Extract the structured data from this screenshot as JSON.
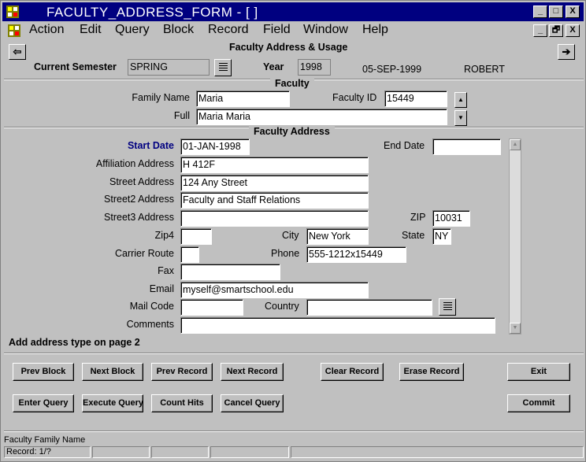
{
  "window": {
    "title": "FACULTY_ADDRESS_FORM - [ ]",
    "controls": {
      "minimize": "_",
      "maximize": "□",
      "close": "X"
    }
  },
  "menu": {
    "items": [
      "Action",
      "Edit",
      "Query",
      "Block",
      "Record",
      "Field",
      "Window",
      "Help"
    ],
    "mdi_controls": {
      "minimize": "_",
      "restore": "🗗",
      "close": "X"
    }
  },
  "header": {
    "form_title": "Faculty Address & Usage",
    "back_arrow": "⇦",
    "forward_arrow": "➔",
    "semester_label": "Current Semester",
    "semester_value": "SPRING",
    "year_label": "Year",
    "year_value": "1998",
    "date": "05-SEP-1999",
    "user": "ROBERT"
  },
  "faculty": {
    "section_title": "Faculty",
    "family_name_label": "Family Name",
    "family_name_value": "Maria",
    "faculty_id_label": "Faculty ID",
    "faculty_id_value": "15449",
    "full_label": "Full",
    "full_value": "Maria  Maria"
  },
  "address": {
    "section_title": "Faculty Address",
    "start_date_label": "Start Date",
    "start_date_value": "01-JAN-1998",
    "end_date_label": "End Date",
    "end_date_value": "",
    "affiliation_label": "Affiliation Address",
    "affiliation_value": "H 412F",
    "street_label": "Street Address",
    "street_value": "124 Any Street",
    "street2_label": "Street2 Address",
    "street2_value": "Faculty and Staff Relations",
    "street3_label": "Street3 Address",
    "street3_value": "",
    "zip_label": "ZIP",
    "zip_value": "10031",
    "zip4_label": "Zip4",
    "zip4_value": "",
    "city_label": "City",
    "city_value": "New York",
    "state_label": "State",
    "state_value": "NY",
    "carrier_label": "Carrier Route",
    "carrier_value": "",
    "phone_label": "Phone",
    "phone_value": "555-1212x15449",
    "fax_label": "Fax",
    "fax_value": "",
    "email_label": "Email",
    "email_value": "myself@smartschool.edu",
    "mail_code_label": "Mail Code",
    "mail_code_value": "",
    "country_label": "Country",
    "country_value": "",
    "comments_label": "Comments",
    "comments_value": "",
    "hint": "Add address type on page 2"
  },
  "buttons": {
    "prev_block": "Prev Block",
    "next_block": "Next Block",
    "prev_record": "Prev Record",
    "next_record": "Next Record",
    "clear_record": "Clear Record",
    "erase_record": "Erase Record",
    "exit": "Exit",
    "enter_query": "Enter Query",
    "execute_query": "Execute Query",
    "count_hits": "Count Hits",
    "cancel_query": "Cancel Query",
    "commit": "Commit"
  },
  "status": {
    "hint": "Faculty Family Name",
    "record": "Record: 1/?"
  },
  "colors": {
    "titlebar": "#000080",
    "window_bg": "#c0c0c0",
    "start_date_label": "#000080"
  }
}
